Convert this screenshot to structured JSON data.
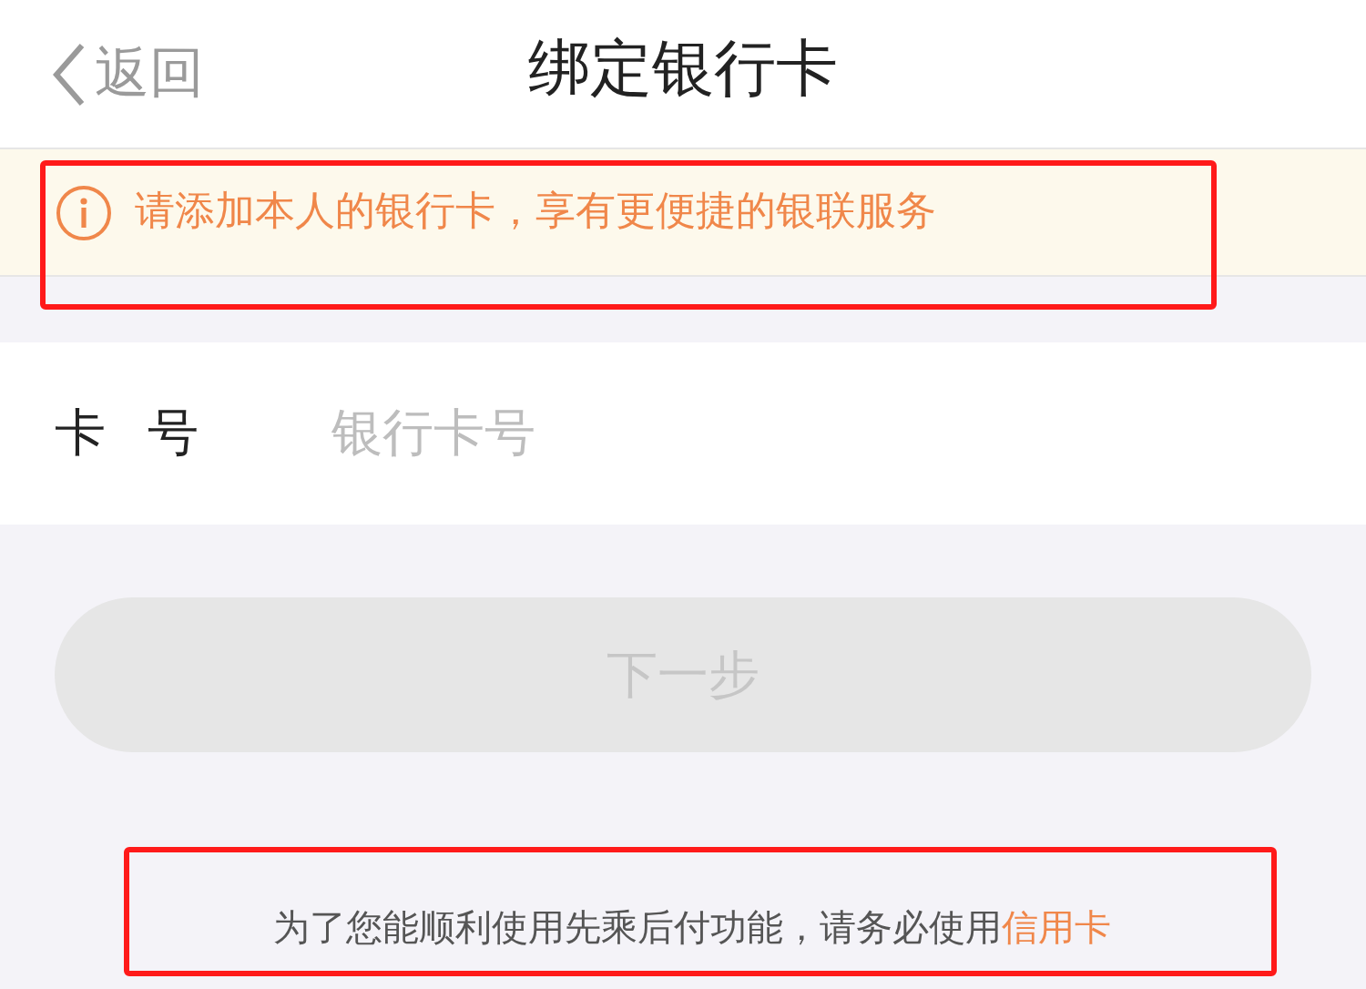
{
  "nav": {
    "back": "返回",
    "title": "绑定银行卡"
  },
  "notice": {
    "text": "请添加本人的银行卡，享有更便捷的银联服务",
    "highlighted": true
  },
  "card_number": {
    "label": "卡 号",
    "placeholder": "银行卡号"
  },
  "next_button": {
    "label": "下一步",
    "disabled": true
  },
  "footer": {
    "text": "为了您能顺利使用先乘后付功能，请务必使用",
    "link": "信用卡",
    "highlighted": true
  }
}
